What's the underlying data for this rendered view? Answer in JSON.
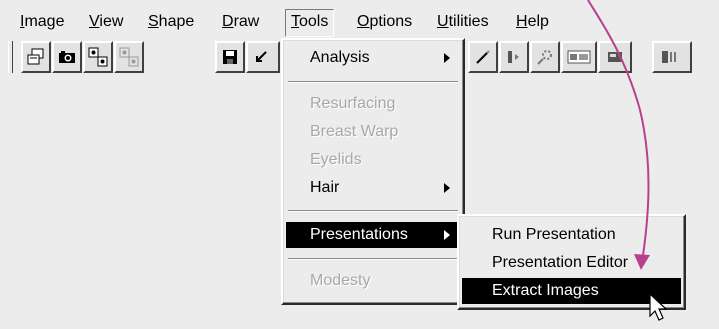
{
  "menubar": {
    "items": [
      {
        "mnemonic": "I",
        "rest": "mage"
      },
      {
        "mnemonic": "V",
        "rest": "iew"
      },
      {
        "mnemonic": "S",
        "rest": "hape"
      },
      {
        "mnemonic": "D",
        "rest": "raw"
      },
      {
        "mnemonic": "T",
        "rest": "ools"
      },
      {
        "mnemonic": "O",
        "rest": "ptions"
      },
      {
        "mnemonic": "U",
        "rest": "tilities"
      },
      {
        "mnemonic": "H",
        "rest": "elp"
      }
    ],
    "active": "Tools"
  },
  "toolbar": {
    "buttons": [
      "window-icon",
      "camera-icon",
      "image-compare-icon",
      "image-compare-disabled-icon",
      "save-icon",
      "undo-icon",
      "pen-icon",
      "split-view-icon",
      "stamp-icon",
      "text-label-icon",
      "select-box-icon",
      "panel-icon"
    ]
  },
  "tools_menu": {
    "items": {
      "analysis": "Analysis",
      "resurfacing": "Resurfacing",
      "breast_warp": "Breast Warp",
      "eyelids": "Eyelids",
      "hair": "Hair",
      "presentations": "Presentations",
      "modesty": "Modesty"
    },
    "disabled": [
      "Resurfacing",
      "Breast Warp",
      "Eyelids",
      "Modesty"
    ],
    "highlighted": "Presentations"
  },
  "presentations_submenu": {
    "items": {
      "run": "Run Presentation",
      "editor": "Presentation Editor",
      "extract": "Extract Images"
    },
    "highlighted": "Extract Images"
  },
  "colors": {
    "annotation_arrow": "#b8418f",
    "highlight": "#000000",
    "face": "#ececec"
  }
}
